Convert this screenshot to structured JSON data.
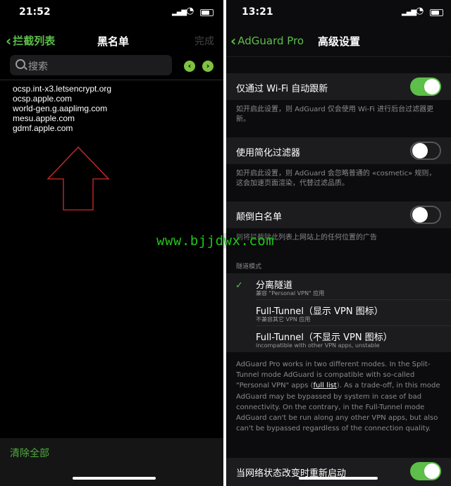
{
  "left": {
    "status_time": "21:52",
    "nav": {
      "back_label": "拦截列表",
      "title": "黑名单",
      "done_label": "完成"
    },
    "search": {
      "placeholder": "搜索"
    },
    "domains": [
      "ocsp.int-x3.letsencrypt.org",
      "ocsp.apple.com",
      "world-gen.g.aaplimg.com",
      "mesu.apple.com",
      "gdmf.apple.com"
    ],
    "annotation": "up-arrow-outline",
    "clear_all_label": "清除全部"
  },
  "right": {
    "status_time": "13:21",
    "nav": {
      "back_label": "AdGuard Pro",
      "title": "高级设置"
    },
    "settings": [
      {
        "label": "仅通过 Wi-Fi 自动跟新",
        "on": true,
        "footnote": "如开启此设置，则 AdGuard 仅会使用 Wi-Fi 进行后台过滤器更新。"
      },
      {
        "label": "使用简化过滤器",
        "on": false,
        "footnote": "如开启此设置，则 AdGuard 会忽略普通的 «cosmetic» 规则，这会加速页面渲染，代替过滤品质。"
      },
      {
        "label": "颠倒白名单",
        "on": false,
        "footnote": "则将拦截除此列表上网站上的任何位置的广告"
      }
    ],
    "tunnel_header": "隧道模式",
    "tunnel_options": [
      {
        "title": "分离隧道",
        "subtitle": "兼容 \"Personal VPN\" 应用",
        "selected": true
      },
      {
        "title": "Full-Tunnel（显示 VPN 图标）",
        "subtitle": "不兼容其它 VPN 应用",
        "selected": false
      },
      {
        "title": "Full-Tunnel（不显示 VPN 图标）",
        "subtitle": "incompatible with other VPN apps, unstable",
        "selected": false
      }
    ],
    "tunnel_description_before": "AdGuard Pro works in two different modes. In the Split-Tunnel mode AdGuard is compatible with so-called \"Personal VPN\" apps (",
    "tunnel_description_link": "full list",
    "tunnel_description_after": "). As a trade-off, in this mode AdGuard may be bypassed by system in case of bad connectivity. On the contrary, in the Full-Tunnel mode AdGuard can't be run along any other VPN apps, but also can't be bypassed regardless of the connection quality.",
    "restart_label": "当网络状态改变时重新启动",
    "restart_on": true
  },
  "watermark": "www.bjjdwx.com",
  "colors": {
    "accent_green": "#5dbe4a",
    "background": "#000000",
    "cell": "#1c1c1e",
    "watermark": "#22c41a"
  }
}
